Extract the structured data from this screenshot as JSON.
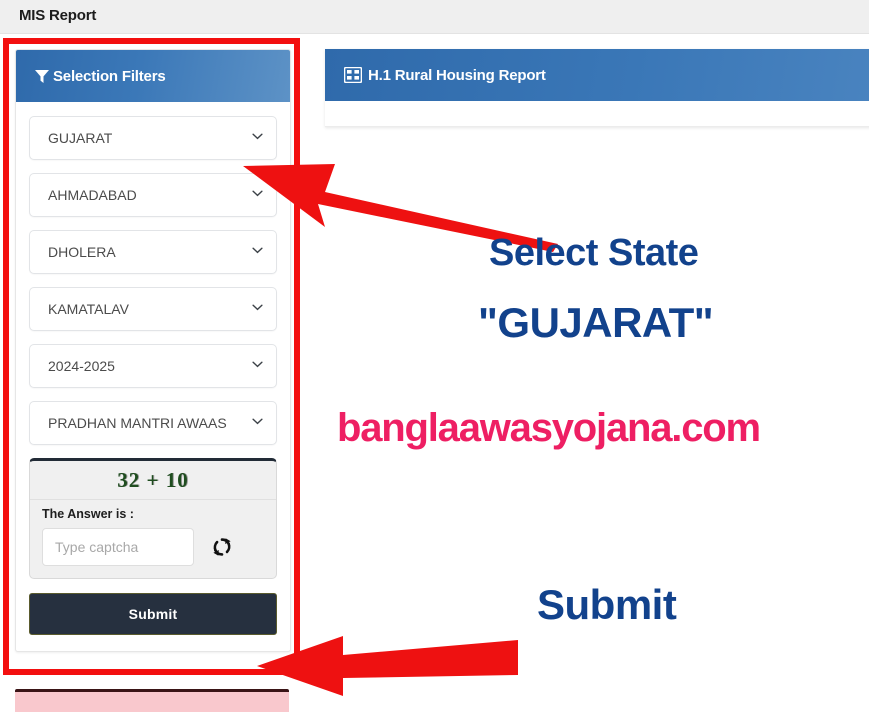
{
  "topbar": {
    "title": "MIS Report"
  },
  "filter_panel": {
    "header_label": "Selection Filters",
    "header_icon": "funnel-filter-icon",
    "selects": [
      {
        "name": "state",
        "value": "GUJARAT"
      },
      {
        "name": "district",
        "value": "AHMADABAD"
      },
      {
        "name": "block",
        "value": "DHOLERA"
      },
      {
        "name": "panchayat",
        "value": "KAMATALAV"
      },
      {
        "name": "financial-year",
        "value": "2024-2025"
      },
      {
        "name": "scheme",
        "value": "PRADHAN MANTRI AWAAS"
      }
    ],
    "captcha": {
      "question": "32 + 10",
      "answer_label": "The Answer is :",
      "input_value": "",
      "input_placeholder": "Type captcha",
      "refresh_icon": "refresh-icon"
    },
    "submit_label": "Submit"
  },
  "report_panel": {
    "header_label": "H.1 Rural Housing Report",
    "header_icon": "table-grid-icon"
  },
  "annotations": {
    "select_state_line1": "Select State",
    "select_state_line2": "\"GUJARAT\"",
    "submit_callout": "Submit",
    "watermark": "banglaawasyojana.com",
    "arrow_top": "red-arrow-pointing-up-left",
    "arrow_bottom": "red-arrow-pointing-left",
    "highlight_box": "red-highlight-rectangle"
  },
  "colors": {
    "annotation_blue": "#12428c",
    "watermark_pink": "#ee1f63",
    "highlight_red": "#f30f0f",
    "header_blue": "#3a77b7",
    "submit_dark": "#26303f",
    "captcha_green": "#1f4d1f"
  }
}
